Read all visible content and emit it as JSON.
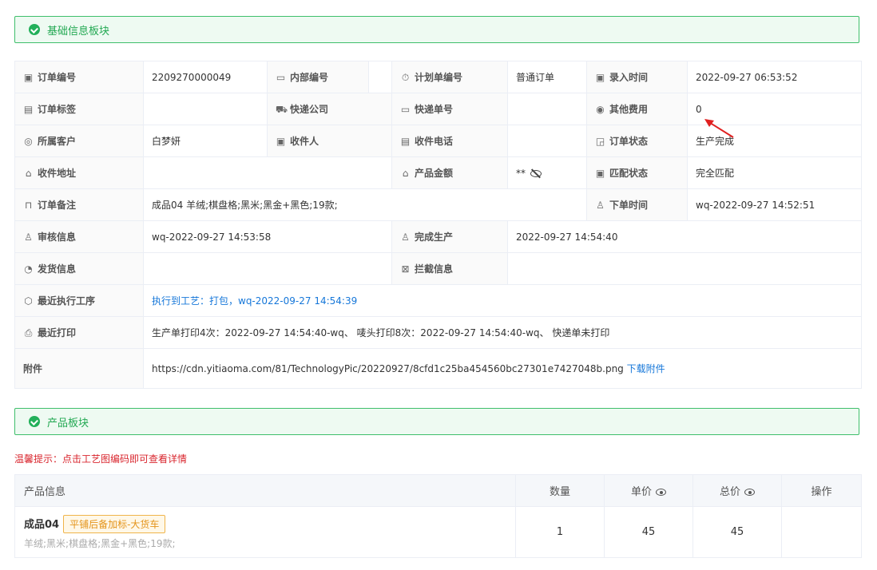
{
  "sections": {
    "basic": "基础信息板块",
    "product": "产品板块"
  },
  "info": {
    "order_no_label": "订单编号",
    "order_no": "2209270000049",
    "internal_no_label": "内部编号",
    "internal_no": "",
    "plan_no_label": "计划单编号",
    "plan_no": "普通订单",
    "entry_time_label": "录入时间",
    "entry_time": "2022-09-27 06:53:52",
    "order_tag_label": "订单标签",
    "order_tag": "",
    "courier_label": "快递公司",
    "courier": "",
    "tracking_label": "快递单号",
    "tracking": "",
    "other_fee_label": "其他费用",
    "other_fee": "0",
    "customer_label": "所属客户",
    "customer": "白梦妍",
    "receiver_label": "收件人",
    "receiver": "",
    "receiver_phone_label": "收件电话",
    "receiver_phone": "",
    "order_status_label": "订单状态",
    "order_status": "生产完成",
    "address_label": "收件地址",
    "address": "",
    "product_amount_label": "产品金额",
    "product_amount": "**",
    "match_status_label": "匹配状态",
    "match_status": "完全匹配",
    "remark_label": "订单备注",
    "remark": "成品04 羊绒;棋盘格;黑米;黑金+黑色;19款;",
    "order_time_label": "下单时间",
    "order_time": "wq-2022-09-27 14:52:51",
    "audit_label": "审核信息",
    "audit": "wq-2022-09-27 14:53:58",
    "done_label": "完成生产",
    "done": "2022-09-27 14:54:40",
    "ship_label": "发货信息",
    "ship": "",
    "intercept_label": "拦截信息",
    "intercept": "",
    "recent_process_label": "最近执行工序",
    "recent_process": "执行到工艺：打包，wq-2022-09-27 14:54:39",
    "recent_print_label": "最近打印",
    "recent_print": "生产单打印4次：2022-09-27 14:54:40-wq、 唛头打印8次：2022-09-27 14:54:40-wq、 快递单未打印",
    "attachment_label": "附件",
    "attachment_url": "https://cdn.yitiaoma.com/81/TechnologyPic/20220927/8cfd1c25ba454560bc27301e7427048b.png",
    "download_label": "下载附件"
  },
  "tip": "温馨提示：点击工艺图编码即可查看详情",
  "product_table": {
    "headers": {
      "info": "产品信息",
      "qty": "数量",
      "unit": "单价",
      "total": "总价",
      "ops": "操作"
    },
    "rows": [
      {
        "name": "成品04",
        "tag": "平铺后备加标-大货车",
        "desc": "羊绒;黑米;棋盘格;黑金+黑色;19款;",
        "qty": "1",
        "unit": "45",
        "total": "45"
      }
    ]
  },
  "colors": {
    "accent_green": "#22a852",
    "link_blue": "#1677d9",
    "tip_red": "#d9262e",
    "tag_orange": "#e4941b"
  }
}
